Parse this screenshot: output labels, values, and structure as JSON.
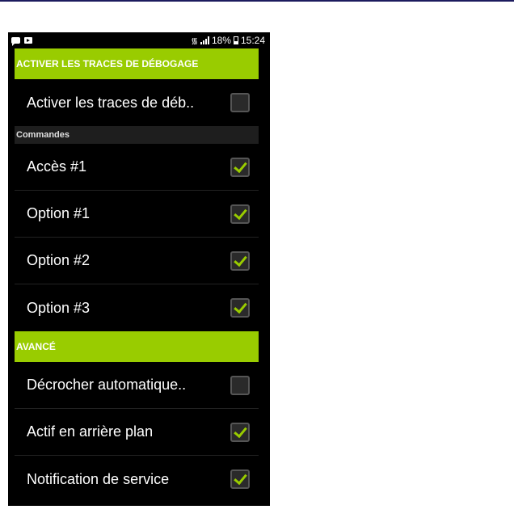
{
  "status_bar": {
    "battery": "18%",
    "time": "15:24",
    "icons": [
      "message-icon",
      "video-icon",
      "wifi-icon",
      "signal-icon",
      "battery-icon"
    ]
  },
  "sections": [
    {
      "header": "ACTIVER LES TRACES DE DÉBOGAGE",
      "items": [
        {
          "label": "Activer les traces de déb..",
          "checked": false
        }
      ]
    },
    {
      "category": "Commandes",
      "items": [
        {
          "label": "Accès #1",
          "checked": true
        },
        {
          "label": "Option #1",
          "checked": true
        },
        {
          "label": "Option #2",
          "checked": true
        },
        {
          "label": "Option #3",
          "checked": true
        }
      ]
    },
    {
      "header": "AVANCÉ",
      "items": [
        {
          "label": "Décrocher automatique..",
          "checked": false
        },
        {
          "label": "Actif en arrière plan",
          "checked": true
        },
        {
          "label": "Notification de service",
          "checked": true
        }
      ]
    }
  ],
  "colors": {
    "accent": "#99cc00",
    "background": "#000000",
    "category_bg": "#1e1e1e"
  }
}
